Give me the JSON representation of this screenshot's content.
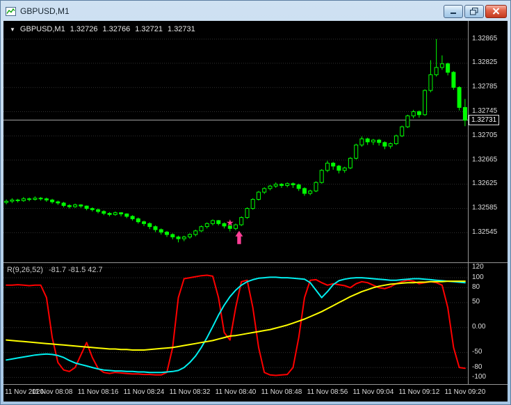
{
  "window": {
    "title": "GBPUSD,M1"
  },
  "header": {
    "dropdown": "▼",
    "symbol": "GBPUSD,M1",
    "open": "1.32726",
    "high": "1.32766",
    "low": "1.32721",
    "close": "1.32731"
  },
  "indicator_header": {
    "name": "R(9,26,52)",
    "values": "-81.7 -81.5 42.7"
  },
  "colors": {
    "background": "#000000",
    "grid": "#333333",
    "bull": "#000000",
    "bear": "#00FF00",
    "candle_outline": "#00FF00",
    "axis_text": "#DEDEDE",
    "axis_line": "#969696",
    "bid_line": "#A8A8A8",
    "marker": "#FF3E96",
    "osc_red": "#FF0000",
    "osc_cyan": "#00F0F0",
    "osc_yellow": "#FFFF00"
  },
  "chart_data": {
    "type": "candlestick",
    "title": "GBPUSD,M1",
    "symbol": "GBPUSD",
    "timeframe": "M1",
    "units_note": "ohlc and unit values u are (price - 1.32) * 100000",
    "price_base": 1.32,
    "price_unit": 1e-05,
    "y_axis": {
      "max_units": 895,
      "min_units": 496,
      "bid_units": 731,
      "bid_label": "1.32731",
      "grid": [
        {
          "u": 865,
          "t": "1.32865"
        },
        {
          "u": 825,
          "t": "1.32825"
        },
        {
          "u": 785,
          "t": "1.32785"
        },
        {
          "u": 745,
          "t": "1.32745"
        },
        {
          "u": 705,
          "t": "1.32705"
        },
        {
          "u": 665,
          "t": "1.32665"
        },
        {
          "u": 625,
          "t": "1.32625"
        },
        {
          "u": 585,
          "t": "1.32585"
        },
        {
          "u": 545,
          "t": "1.32545"
        }
      ]
    },
    "x_axis": {
      "labels": [
        {
          "m": 0,
          "t": "11 Nov 2020"
        },
        {
          "m": 8,
          "t": "11 Nov 08:08"
        },
        {
          "m": 16,
          "t": "11 Nov 08:16"
        },
        {
          "m": 24,
          "t": "11 Nov 08:24"
        },
        {
          "m": 32,
          "t": "11 Nov 08:32"
        },
        {
          "m": 40,
          "t": "11 Nov 08:40"
        },
        {
          "m": 48,
          "t": "11 Nov 08:48"
        },
        {
          "m": 56,
          "t": "11 Nov 08:56"
        },
        {
          "m": 64,
          "t": "11 Nov 09:04"
        },
        {
          "m": 72,
          "t": "11 Nov 09:12"
        },
        {
          "m": 80,
          "t": "11 Nov 09:20"
        }
      ]
    },
    "ohlc": [
      [
        595,
        600,
        592,
        597
      ],
      [
        597,
        602,
        594,
        599
      ],
      [
        599,
        601,
        595,
        598
      ],
      [
        598,
        604,
        596,
        601
      ],
      [
        601,
        603,
        597,
        600
      ],
      [
        600,
        605,
        598,
        602
      ],
      [
        602,
        604,
        598,
        601
      ],
      [
        601,
        603,
        596,
        599
      ],
      [
        599,
        601,
        593,
        596
      ],
      [
        596,
        598,
        591,
        594
      ],
      [
        594,
        596,
        587,
        590
      ],
      [
        590,
        592,
        585,
        588
      ],
      [
        588,
        593,
        586,
        591
      ],
      [
        591,
        592,
        586,
        589
      ],
      [
        589,
        590,
        582,
        585
      ],
      [
        585,
        587,
        580,
        583
      ],
      [
        583,
        585,
        577,
        580
      ],
      [
        580,
        582,
        574,
        577
      ],
      [
        577,
        579,
        572,
        575
      ],
      [
        575,
        580,
        573,
        578
      ],
      [
        578,
        579,
        572,
        576
      ],
      [
        576,
        577,
        569,
        572
      ],
      [
        572,
        574,
        565,
        568
      ],
      [
        568,
        570,
        560,
        563
      ],
      [
        563,
        565,
        556,
        560
      ],
      [
        560,
        562,
        551,
        555
      ],
      [
        555,
        557,
        546,
        550
      ],
      [
        550,
        552,
        542,
        546
      ],
      [
        546,
        548,
        538,
        542
      ],
      [
        542,
        544,
        534,
        538
      ],
      [
        538,
        540,
        529,
        535
      ],
      [
        535,
        540,
        531,
        538
      ],
      [
        538,
        544,
        535,
        542
      ],
      [
        542,
        550,
        539,
        548
      ],
      [
        548,
        557,
        546,
        555
      ],
      [
        555,
        562,
        552,
        560
      ],
      [
        560,
        567,
        557,
        565
      ],
      [
        565,
        566,
        557,
        560
      ],
      [
        560,
        562,
        552,
        556
      ],
      [
        556,
        558,
        547,
        552
      ],
      [
        552,
        560,
        549,
        558
      ],
      [
        558,
        572,
        556,
        570
      ],
      [
        570,
        587,
        568,
        585
      ],
      [
        585,
        602,
        583,
        600
      ],
      [
        600,
        614,
        598,
        612
      ],
      [
        612,
        620,
        609,
        618
      ],
      [
        618,
        624,
        615,
        622
      ],
      [
        622,
        628,
        619,
        625
      ],
      [
        625,
        627,
        619,
        623
      ],
      [
        623,
        628,
        620,
        626
      ],
      [
        626,
        628,
        619,
        624
      ],
      [
        624,
        626,
        614,
        618
      ],
      [
        618,
        620,
        606,
        610
      ],
      [
        610,
        616,
        607,
        614
      ],
      [
        614,
        630,
        612,
        628
      ],
      [
        628,
        650,
        626,
        648
      ],
      [
        648,
        664,
        645,
        660
      ],
      [
        660,
        662,
        649,
        655
      ],
      [
        655,
        657,
        643,
        648
      ],
      [
        648,
        654,
        644,
        652
      ],
      [
        652,
        670,
        650,
        668
      ],
      [
        668,
        692,
        666,
        690
      ],
      [
        690,
        704,
        687,
        700
      ],
      [
        700,
        702,
        690,
        695
      ],
      [
        695,
        700,
        690,
        698
      ],
      [
        698,
        700,
        689,
        694
      ],
      [
        694,
        696,
        683,
        688
      ],
      [
        688,
        694,
        684,
        692
      ],
      [
        692,
        707,
        690,
        705
      ],
      [
        705,
        722,
        703,
        720
      ],
      [
        720,
        740,
        718,
        738
      ],
      [
        738,
        748,
        734,
        745
      ],
      [
        745,
        747,
        735,
        740
      ],
      [
        740,
        782,
        738,
        780
      ],
      [
        780,
        830,
        777,
        806
      ],
      [
        806,
        865,
        803,
        818
      ],
      [
        818,
        838,
        814,
        824
      ],
      [
        824,
        826,
        805,
        810
      ],
      [
        810,
        812,
        781,
        785
      ],
      [
        785,
        787,
        747,
        752
      ],
      [
        752,
        766,
        721,
        731
      ]
    ],
    "marker": {
      "type": "buy-signal",
      "color_key": "marker",
      "star": {
        "i": 39.0,
        "u": 561
      },
      "arrow": {
        "i": 40.6,
        "u": 548
      }
    },
    "oscillator": {
      "name": "R(9,26,52)",
      "display_values": [
        -81.7,
        -81.5,
        42.7
      ],
      "range": [
        -112,
        128
      ],
      "scale_labels": [
        {
          "v": 120,
          "t": "120"
        },
        {
          "v": 100,
          "t": "100"
        },
        {
          "v": 80,
          "t": "80"
        },
        {
          "v": 50,
          "t": "50"
        },
        {
          "v": 0,
          "t": "0.00"
        },
        {
          "v": -50,
          "t": "-50"
        },
        {
          "v": -80,
          "t": "-80"
        },
        {
          "v": -100,
          "t": "-100"
        }
      ],
      "series": [
        {
          "name": "red",
          "color_key": "osc_red",
          "width": 2,
          "values": [
            85,
            85,
            86,
            85,
            84,
            85,
            85,
            60,
            -20,
            -70,
            -85,
            -88,
            -80,
            -55,
            -30,
            -60,
            -82,
            -90,
            -92,
            -90,
            -91,
            -92,
            -93,
            -93,
            -94,
            -94,
            -95,
            -95,
            -90,
            -40,
            60,
            98,
            100,
            102,
            104,
            105,
            103,
            60,
            -10,
            -25,
            40,
            92,
            95,
            40,
            -40,
            -90,
            -95,
            -96,
            -95,
            -94,
            -80,
            -20,
            60,
            95,
            96,
            90,
            85,
            88,
            86,
            84,
            80,
            88,
            92,
            90,
            85,
            80,
            78,
            82,
            88,
            92,
            95,
            93,
            88,
            90,
            92,
            90,
            85,
            40,
            -40,
            -80,
            -81.7
          ]
        },
        {
          "name": "cyan",
          "color_key": "osc_cyan",
          "width": 2,
          "values": [
            -65,
            -63,
            -61,
            -59,
            -57,
            -55,
            -54,
            -53,
            -54,
            -56,
            -60,
            -66,
            -71,
            -74,
            -77,
            -80,
            -83,
            -85,
            -86,
            -87,
            -87,
            -88,
            -88,
            -89,
            -89,
            -90,
            -90,
            -90,
            -89,
            -88,
            -86,
            -80,
            -70,
            -57,
            -40,
            -20,
            2,
            25,
            45,
            62,
            75,
            85,
            92,
            96,
            99,
            100,
            101,
            101,
            100,
            100,
            99,
            98,
            97,
            90,
            75,
            60,
            72,
            86,
            94,
            97,
            99,
            100,
            100,
            99,
            98,
            97,
            96,
            95,
            95,
            96,
            97,
            98,
            98,
            97,
            96,
            95,
            94,
            93,
            92,
            91,
            90
          ]
        },
        {
          "name": "yellow",
          "color_key": "osc_yellow",
          "width": 2,
          "values": [
            -25,
            -26,
            -27,
            -28,
            -29,
            -30,
            -31,
            -32,
            -33,
            -34,
            -35,
            -36,
            -37,
            -38,
            -39,
            -40,
            -41,
            -42,
            -43,
            -43,
            -44,
            -44,
            -45,
            -45,
            -45,
            -44,
            -43,
            -42,
            -41,
            -40,
            -38,
            -36,
            -34,
            -32,
            -30,
            -28,
            -26,
            -23,
            -20,
            -17,
            -16,
            -14,
            -12,
            -10,
            -8,
            -6,
            -4,
            -1,
            2,
            5,
            9,
            13,
            17,
            22,
            27,
            32,
            38,
            44,
            50,
            56,
            62,
            67,
            72,
            76,
            80,
            83,
            85,
            87,
            88,
            89,
            90,
            90,
            91,
            91,
            92,
            92,
            92,
            93,
            93,
            93,
            93
          ]
        }
      ]
    }
  }
}
